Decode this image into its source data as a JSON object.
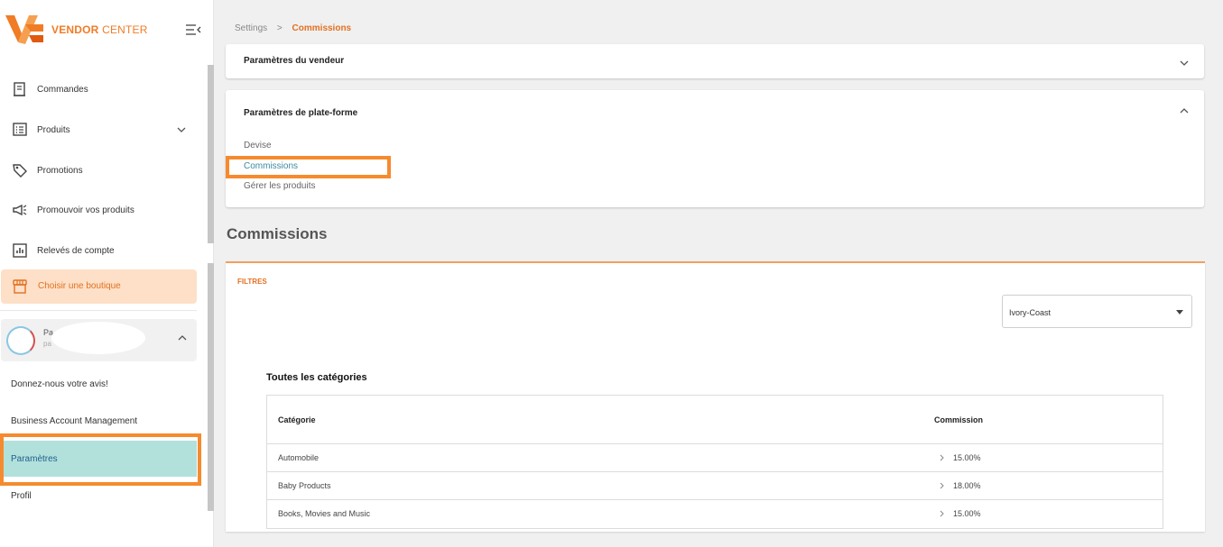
{
  "brand": {
    "name_bold": "VENDOR",
    "name_thin": "CENTER",
    "accent_color": "#f07c26"
  },
  "sidebar": {
    "items": [
      {
        "label": "Commandes",
        "icon": "receipt-icon"
      },
      {
        "label": "Produits",
        "icon": "list-icon"
      },
      {
        "label": "Promotions",
        "icon": "tag-icon"
      },
      {
        "label": "Promouvoir vos produits",
        "icon": "megaphone-icon"
      },
      {
        "label": "Relevés de compte",
        "icon": "chart-icon"
      }
    ],
    "shop_button": "Choisir une boutique",
    "user": {
      "name": "Pa",
      "sub": "pa"
    },
    "feedback": "Donnez-nous votre avis!",
    "business": "Business Account Management",
    "settings": "Paramètres",
    "profile": "Profil"
  },
  "breadcrumb": {
    "parent": "Settings",
    "separator": ">",
    "current": "Commissions"
  },
  "vendor_card": {
    "title": "Paramètres du vendeur"
  },
  "platform_card": {
    "title": "Paramètres de plate-forme",
    "links": [
      "Devise",
      "Commissions",
      "Gérer les produits"
    ]
  },
  "page_title": "Commissions",
  "filters": {
    "label": "FILTRES",
    "country": "Ivory-Coast"
  },
  "table": {
    "heading": "Toutes les catégories",
    "columns": [
      "Catégorie",
      "Commission"
    ],
    "rows": [
      {
        "category": "Automobile",
        "commission": "15.00%"
      },
      {
        "category": "Baby Products",
        "commission": "18.00%"
      },
      {
        "category": "Books, Movies and Music",
        "commission": "15.00%"
      }
    ]
  }
}
